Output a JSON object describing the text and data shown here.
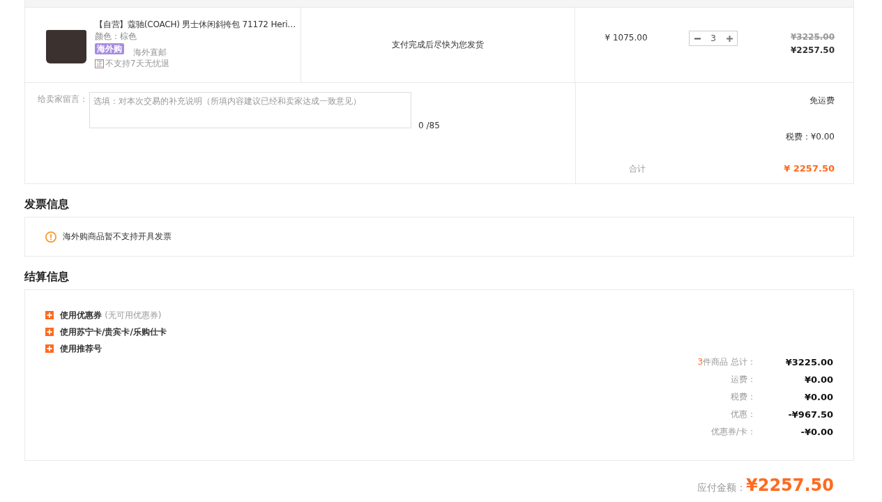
{
  "order_table": {
    "items": [
      {
        "title": "【自营】蔻驰(COACH) 男士休闲斜挎包 71172 Heri…",
        "variant": "颜色：棕色",
        "badge": "海外购",
        "shipping_type": "海外直邮",
        "policy_mark": "正",
        "return_policy": "不支持7天无忧退",
        "delivery_note": "支付完成后尽快为您发货",
        "unit_price": "¥ 1075.00",
        "quantity": "3",
        "original_subtotal": "¥3225.00",
        "subtotal": "¥2257.50"
      }
    ],
    "message": {
      "label": "给卖家留言：",
      "placeholder": "选填：对本次交易的补充说明（所填内容建议已经和卖家达成一致意见）",
      "counter": "0 /85"
    },
    "summary": {
      "shipping": "免运费",
      "tax": "税费：¥0.00",
      "total_label": "合计",
      "total": "¥ 2257.50"
    }
  },
  "invoice": {
    "title": "发票信息",
    "notice": "海外购商品暂不支持开具发票"
  },
  "settlement": {
    "title": "结算信息",
    "options": [
      {
        "label": "使用优惠券",
        "hint": "(无可用优惠券)",
        "expanded": false
      },
      {
        "label": "使用苏宁卡/贵宾卡/乐购仕卡",
        "expanded": false
      },
      {
        "label": "使用推荐号",
        "expanded": false
      }
    ],
    "totals": [
      {
        "count": "3",
        "label": "件商品 总计：",
        "value": "¥3225.00"
      },
      {
        "label": "运费：",
        "value": "¥0.00"
      },
      {
        "label": "税费：",
        "value": "¥0.00"
      },
      {
        "label": "优惠：",
        "value": "-¥967.50"
      },
      {
        "label": "优惠券/卡：",
        "value": "-¥0.00"
      }
    ]
  },
  "payable": {
    "label": "应付金额：",
    "amount": "¥2257.50"
  }
}
